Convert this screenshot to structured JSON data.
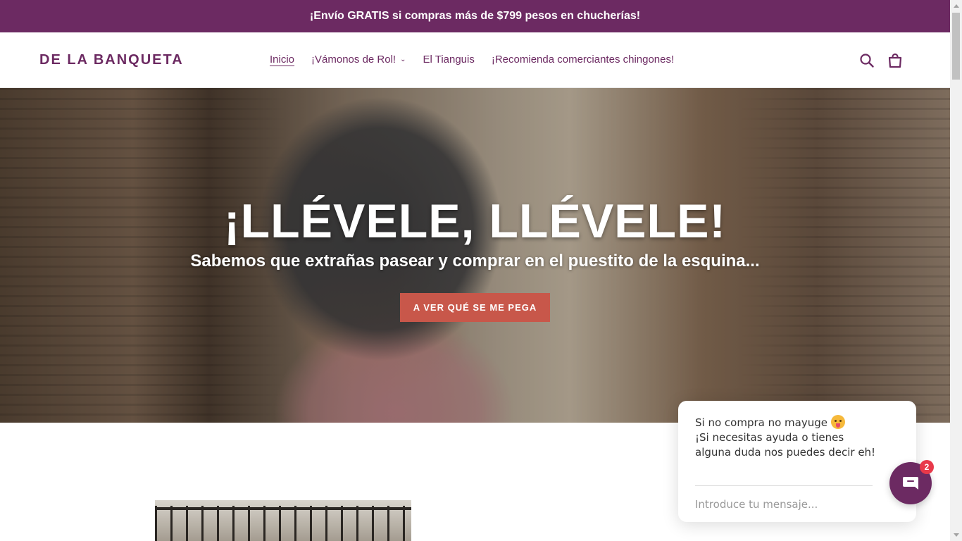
{
  "announcement": {
    "text": "¡Envío GRATIS si compras más de $799 pesos en chucherías!"
  },
  "header": {
    "logo": "DE LA BANQUETA",
    "nav": [
      {
        "label": "Inicio",
        "active": true
      },
      {
        "label": "¡Vámonos de Rol!",
        "has_dropdown": true
      },
      {
        "label": "El Tianguis"
      },
      {
        "label": "¡Recomienda comerciantes chingones!"
      }
    ],
    "icons": [
      "search-icon",
      "cart-icon"
    ]
  },
  "hero": {
    "title": "¡LLÉVELE, LLÉVELE!",
    "subtitle": "Sabemos que extrañas pasear y comprar en el puestito de la esquina...",
    "button_label": "A VER QUÉ SE ME PEGA"
  },
  "chat": {
    "message_line1": "Si no compra no mayuge",
    "message_line2": "¡Si necesitas ayuda o tienes alguna duda nos puedes decir eh!",
    "input_placeholder": "Introduce tu mensaje...",
    "badge_count": "2"
  },
  "colors": {
    "brand": "#6c2a62",
    "button": "#c8574a",
    "badge": "#e8394a"
  }
}
